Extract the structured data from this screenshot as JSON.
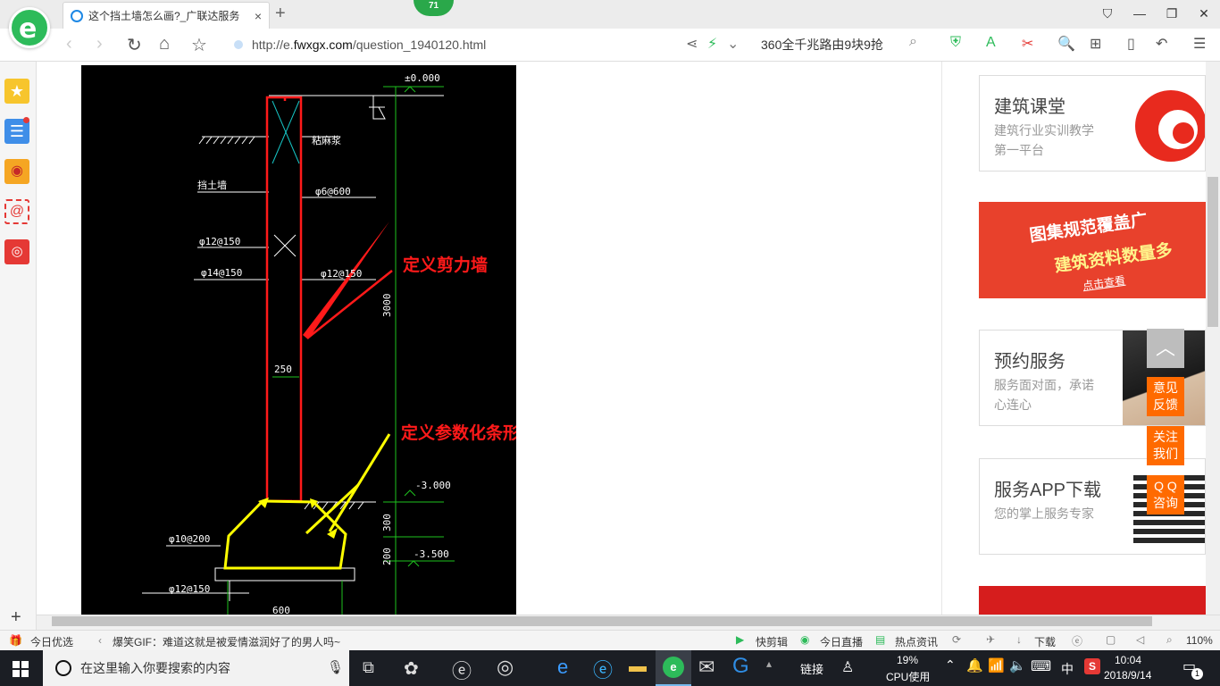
{
  "browser": {
    "tab_title": "这个挡土墙怎么画?_广联达服务",
    "tab_close": "×",
    "new_tab": "+",
    "badge_count": "71",
    "url_host": "http://e.",
    "url_domain": "fwxgx.com",
    "url_path": "/question_1940120.html",
    "search_text": "360全千兆路由9块9抢",
    "window_controls": [
      "⛉",
      "—",
      "❐",
      "✕"
    ]
  },
  "drawing": {
    "labels": {
      "elev_top": "±0.000",
      "tie": "粘麻浆",
      "wall_label": "挡土墙",
      "phi6": "φ6@600",
      "phi12a": "φ12@150",
      "phi14": "φ14@150",
      "phi12b": "φ12@150",
      "dim3000": "3000",
      "dim250": "250",
      "elev_m3": "-3.000",
      "dim300": "300",
      "dim200": "200",
      "elev_m35": "-3.500",
      "phi10": "φ10@200",
      "phi12c": "φ12@150",
      "dim_bottom": "600"
    },
    "annotations": {
      "shear_wall": "定义剪力墙",
      "strip_foundation": "定义参数化条形基础单元"
    }
  },
  "sidebar": {
    "cards": [
      {
        "title": "建筑课堂",
        "subtitle": "建筑行业实训教学第一平台"
      },
      {
        "title": "预约服务",
        "subtitle": "服务面对面，承诺心连心"
      },
      {
        "title": "服务APP下载",
        "subtitle": "您的掌上服务专家"
      }
    ],
    "banner": {
      "line1": "图集规范覆盖广",
      "line2": "建筑资料数量多",
      "cta": "点击查看"
    },
    "float_buttons": [
      "意见\n反馈",
      "关注\n我们",
      "Q Q\n咨询"
    ]
  },
  "status_bar": {
    "daily": "今日优选",
    "news": "爆笑GIF：难道这就是被爱情滋润好了的男人吗~",
    "items": [
      "快剪辑",
      "今日直播",
      "热点资讯",
      "下载"
    ],
    "zoom": "110%"
  },
  "taskbar": {
    "search_placeholder": "在这里输入你要搜索的内容",
    "link_label": "链接",
    "cpu_percent": "19%",
    "cpu_label": "CPU使用",
    "ime": "中",
    "time": "10:04",
    "date": "2018/9/14",
    "notif_count": "1"
  },
  "colors": {
    "accent_green": "#2dbb5a",
    "orange": "#ff6a00",
    "red_annot": "#ff1a1a",
    "yellow_annot": "#ffff00",
    "cad_green": "#1ec21e"
  }
}
